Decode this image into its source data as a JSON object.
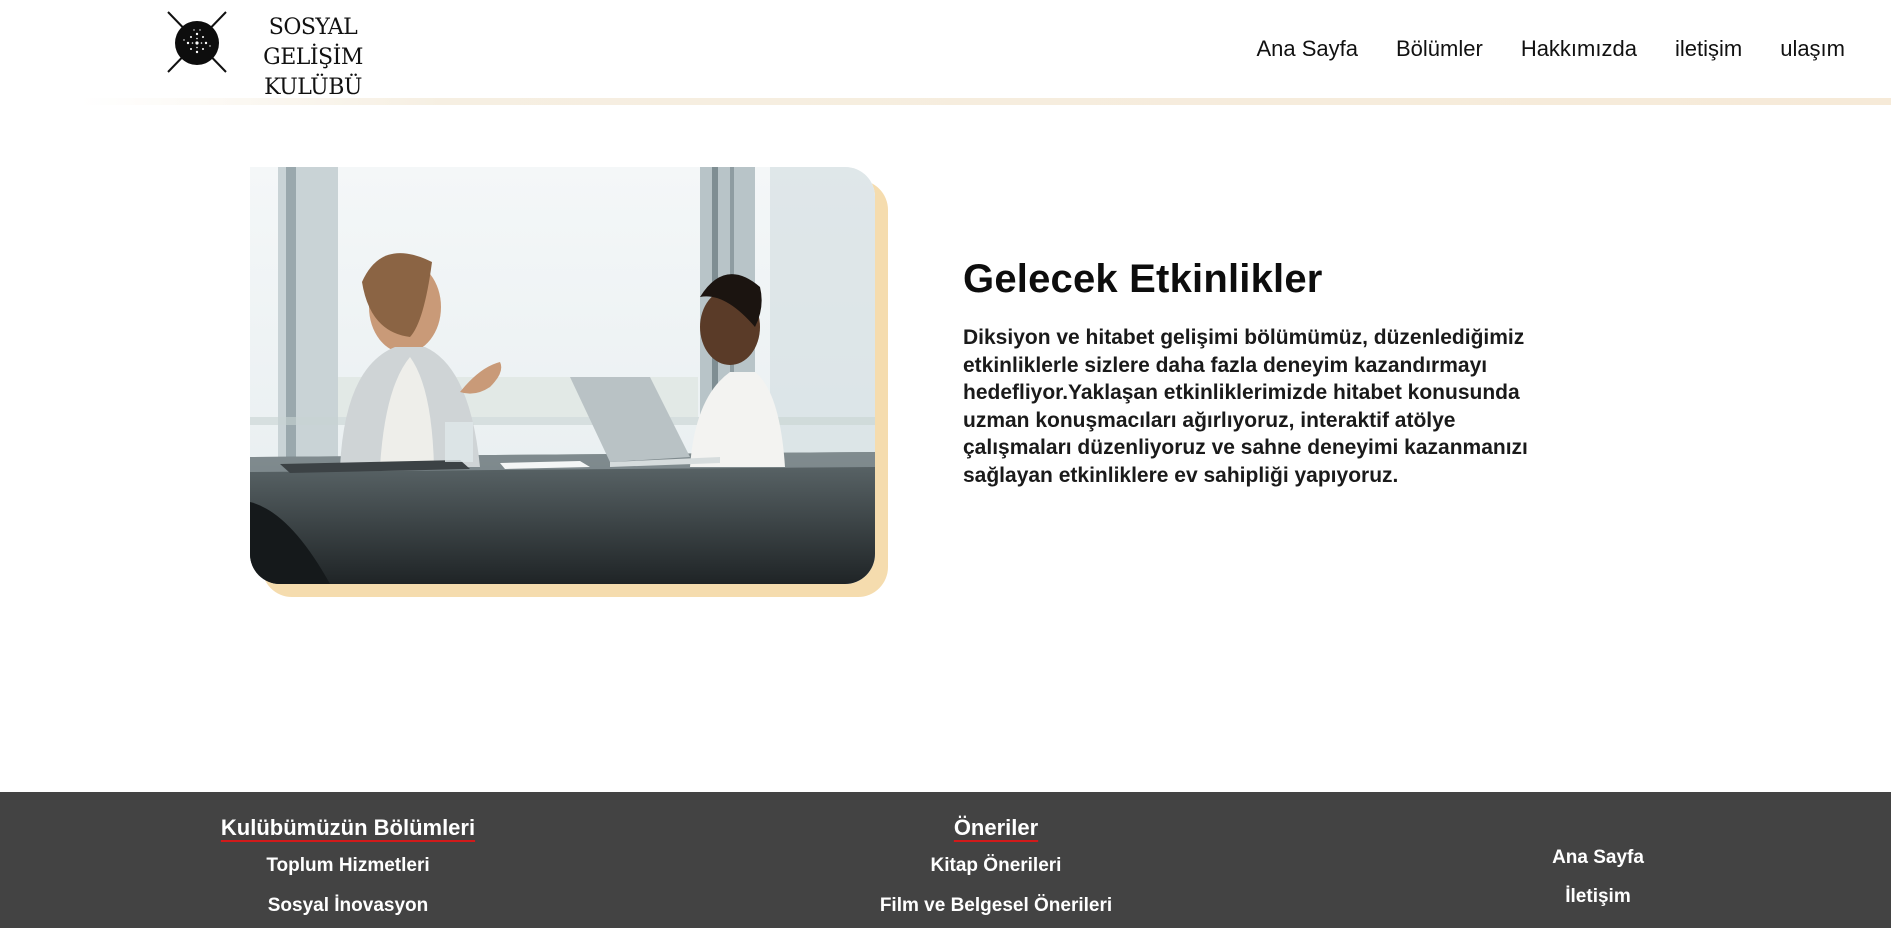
{
  "header": {
    "logo_line1": "SOSYAL GELİŞİM",
    "logo_line2": "KULÜBÜ",
    "nav": [
      "Ana Sayfa",
      "Bölümler",
      "Hakkımızda",
      "iletişim",
      "ulaşım"
    ]
  },
  "main": {
    "image_icon": "meeting-photo",
    "title": "Gelecek Etkinlikler",
    "body": "Diksiyon ve hitabet gelişimi bölümümüz, düzenlediğimiz etkinliklerle sizlere daha fazla deneyim kazandırmayı hedefliyor.Yaklaşan etkinliklerimizde hitabet konusunda uzman konuşmacıları ağırlıyoruz, interaktif atölye çalışmaları düzenliyoruz ve sahne deneyimi kazanmanızı sağlayan etkinliklere ev sahipliği yapıyoruz."
  },
  "footer": {
    "sections_title": "Kulübümüzün Bölümleri",
    "sections": [
      "Toplum Hizmetleri",
      "Sosyal İnovasyon"
    ],
    "recommendations_title": "Öneriler",
    "recommendations": [
      "Kitap Önerileri",
      "Film ve Belgesel Önerileri"
    ],
    "links": [
      "Ana Sayfa",
      "İletişim"
    ]
  },
  "colors": {
    "footer_bg": "#434343",
    "photo_accent": "#f5dcae",
    "heading_underline": "#d11a1a"
  }
}
